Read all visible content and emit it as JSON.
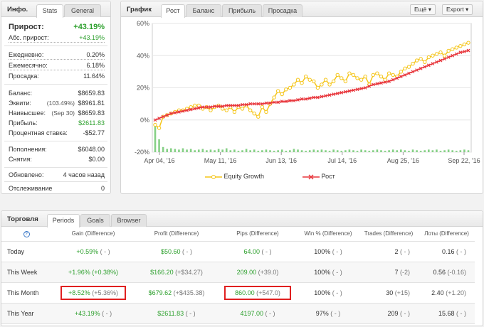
{
  "info": {
    "title": "Инфо.",
    "tabs": [
      "Stats",
      "General"
    ],
    "rows": [
      {
        "label": "Прирост:",
        "value": "+43.19%"
      },
      {
        "label": "Абс. прирост:",
        "value": "+43.19%"
      },
      {
        "label": "Ежедневно:",
        "value": "0.20%"
      },
      {
        "label": "Ежемесячно:",
        "value": "6.18%"
      },
      {
        "label": "Просадка:",
        "value": "11.64%"
      },
      {
        "label": "Баланс:",
        "value": "$8659.83"
      },
      {
        "label": "Эквити:",
        "sub": "(103.49%)",
        "value": "$8961.81"
      },
      {
        "label": "Наивысшее:",
        "sub": "(Sep 30)",
        "value": "$8659.83"
      },
      {
        "label": "Прибыль:",
        "value": "$2611.83"
      },
      {
        "label": "Процентная ставка:",
        "value": "-$52.77"
      },
      {
        "label": "Пополнения:",
        "value": "$6048.00"
      },
      {
        "label": "Снятия:",
        "value": "$0.00"
      },
      {
        "label": "Обновлено:",
        "value": "4 часов назад"
      },
      {
        "label": "Отслеживание",
        "value": "0"
      }
    ]
  },
  "chart_panel": {
    "title": "График",
    "tabs": [
      "Рост",
      "Баланс",
      "Прибыль",
      "Просадка"
    ],
    "more_button": "Ещё",
    "export_button": "Export"
  },
  "chart_data": {
    "type": "line",
    "y_ticks": [
      "60%",
      "40%",
      "20%",
      "0%",
      "-20%"
    ],
    "ylim": [
      -20,
      60
    ],
    "x_ticks": [
      "Apr 04, '16",
      "May 11, '16",
      "Jun 13, '16",
      "Jul 14, '16",
      "Aug 25, '16",
      "Sep 22, '16"
    ],
    "series": [
      {
        "name": "Equity Growth",
        "color": "#f5c518",
        "values": [
          -3,
          -5,
          2,
          3,
          4,
          5,
          6,
          6,
          7,
          8,
          9,
          9,
          7,
          8,
          6,
          8,
          9,
          7,
          6,
          8,
          5,
          8,
          7,
          9,
          6,
          4,
          2,
          8,
          5,
          10,
          14,
          18,
          16,
          19,
          20,
          22,
          25,
          23,
          27,
          25,
          24,
          20,
          22,
          25,
          22,
          24,
          28,
          26,
          24,
          29,
          28,
          26,
          25,
          27,
          22,
          28,
          29,
          27,
          25,
          29,
          28,
          27,
          30,
          32,
          33,
          35,
          37,
          38,
          36,
          39,
          40,
          41,
          42,
          40,
          43,
          44,
          45,
          46,
          47,
          48
        ]
      },
      {
        "name": "Рост",
        "color": "#e8363c",
        "values": [
          0,
          1,
          2,
          3,
          4,
          4.5,
          5,
          5.5,
          6,
          6.5,
          7,
          7.5,
          8,
          8,
          8,
          8.5,
          8.5,
          8.5,
          9,
          9,
          9,
          9,
          9.5,
          9.5,
          10,
          10,
          10,
          10,
          10.5,
          10.5,
          11,
          11,
          11.5,
          11.5,
          12,
          12,
          12.5,
          13,
          13,
          13.5,
          14,
          14,
          14.5,
          15,
          15.5,
          16,
          16.5,
          17,
          17.5,
          18,
          18.5,
          19,
          19.5,
          20,
          21,
          22,
          22.5,
          23,
          23.5,
          24,
          25,
          26,
          27,
          28,
          29,
          30,
          31,
          32,
          33,
          34,
          35,
          36,
          37,
          38,
          39,
          40,
          41,
          42,
          42.5,
          43.19
        ]
      },
      {
        "name": "bars",
        "color": "#86d086",
        "values": [
          40,
          20,
          8,
          5,
          6,
          5,
          4,
          6,
          4,
          5,
          3,
          4,
          5,
          3,
          4,
          3,
          5,
          4,
          6,
          3,
          4,
          2,
          3,
          5,
          3,
          4,
          2,
          3,
          4,
          3,
          2,
          3,
          4,
          2,
          3,
          5,
          4,
          3,
          2,
          3,
          4,
          3,
          4,
          3,
          2,
          4,
          3,
          2,
          3,
          4,
          3,
          2,
          4,
          3,
          2,
          3,
          4,
          3,
          2,
          3,
          4,
          3,
          4,
          3,
          2,
          4,
          3,
          2,
          3,
          4,
          3,
          4,
          2,
          3,
          4,
          3,
          2,
          3,
          4,
          3
        ]
      }
    ],
    "legend": [
      "Equity Growth",
      "Рост"
    ]
  },
  "trade": {
    "title": "Торговля",
    "tabs": [
      "Periods",
      "Goals",
      "Browser"
    ],
    "help_icon": "?",
    "headers": [
      "Gain (Difference)",
      "Profit (Difference)",
      "Pips (Difference)",
      "Win % (Difference)",
      "Trades (Difference)",
      "Лоты (Difference)"
    ],
    "rows": [
      {
        "label": "Today",
        "gain": "+0.59%",
        "gain_d": "( - )",
        "profit": "$50.60",
        "profit_d": "( - )",
        "pips": "64.00",
        "pips_d": "( - )",
        "win": "100%",
        "win_d": "( - )",
        "trades": "2",
        "trades_d": "( - )",
        "lots": "0.16",
        "lots_d": "( - )"
      },
      {
        "label": "This Week",
        "gain": "+1.96%",
        "gain_d": "(+0.38%)",
        "profit": "$166.20",
        "profit_d": "(+$34.27)",
        "pips": "209.00",
        "pips_d": "(+39.0)",
        "win": "100%",
        "win_d": "( - )",
        "trades": "7",
        "trades_d": "(-2)",
        "lots": "0.56",
        "lots_d": "(-0.16)"
      },
      {
        "label": "This Month",
        "gain": "+8.52%",
        "gain_d": "(+5.36%)",
        "profit": "$679.62",
        "profit_d": "(+$435.38)",
        "pips": "860.00",
        "pips_d": "(+547.0)",
        "win": "100%",
        "win_d": "( - )",
        "trades": "30",
        "trades_d": "(+15)",
        "lots": "2.40",
        "lots_d": "(+1.20)"
      },
      {
        "label": "This Year",
        "gain": "+43.19%",
        "gain_d": "( - )",
        "profit": "$2611.83",
        "profit_d": "( - )",
        "pips": "4197.00",
        "pips_d": "( - )",
        "win": "97%",
        "win_d": "( - )",
        "trades": "209",
        "trades_d": "( - )",
        "lots": "15.68",
        "lots_d": "( - )"
      }
    ]
  }
}
